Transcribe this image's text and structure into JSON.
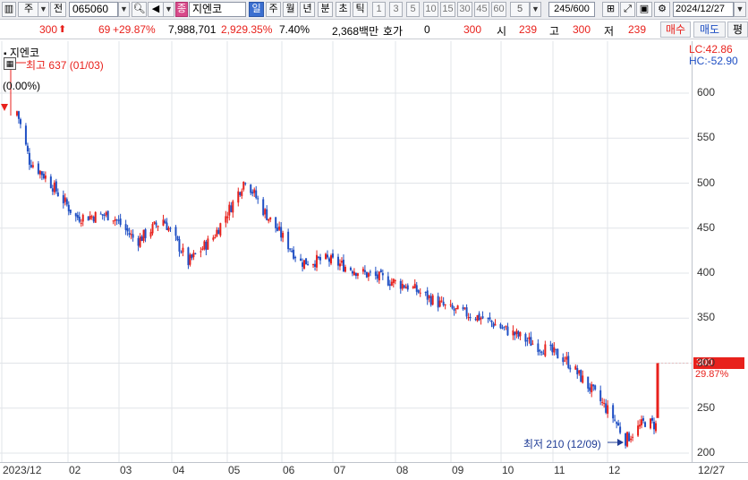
{
  "toolbar": {
    "market": "주",
    "type_label": "전",
    "code": "065060",
    "badge": "종",
    "name": "지엔코",
    "periods": [
      "일",
      "주",
      "월",
      "년",
      "분",
      "초",
      "틱"
    ],
    "selected_period": "일",
    "numbers": [
      "1",
      "3",
      "5",
      "10",
      "15",
      "30",
      "45",
      "60"
    ],
    "n_value": "5",
    "count": "245/600",
    "date": "2024/12/27"
  },
  "info": {
    "price": "300",
    "change": "69",
    "change_pct": "+29.87%",
    "volume": "7,988,701",
    "vol_pct": "2,929.35%",
    "turnover": "7.40%",
    "amount": "2,368백만",
    "hoga_label": "호가",
    "hoga_value": "0",
    "hoga_price": "300",
    "open_label": "시",
    "open": "239",
    "high_label": "고",
    "high": "300",
    "low_label": "저",
    "low": "239",
    "buy_label": "매수",
    "sell_label": "매도",
    "eval_label": "평"
  },
  "chart": {
    "legend_name": "지엔코",
    "max_label": "최고 637 (01/03)",
    "pct_label": "(0.00%)",
    "min_label": "최저 210 (12/09)",
    "lc_label": "LC:42.86",
    "hc_label": "HC:-52.90",
    "last_price": "300",
    "last_pct": "29.87%",
    "y_ticks": [
      "600",
      "550",
      "500",
      "450",
      "400",
      "350",
      "300",
      "250",
      "200"
    ],
    "x_ticks": [
      "2023/12",
      "02",
      "03",
      "04",
      "05",
      "06",
      "07",
      "08",
      "09",
      "10",
      "11",
      "12",
      "12/27"
    ],
    "colors": {
      "up": "#e8211c",
      "down": "#1f4fc4",
      "grid": "#e1e4e8"
    }
  },
  "chart_data": {
    "type": "candlestick",
    "ylim": [
      200,
      610
    ],
    "x_start": "2023/12",
    "x_end": "12/27",
    "anchors": [
      {
        "x": "2024/01/03",
        "close": 580
      },
      {
        "x": "2024/01/10",
        "close": 525
      },
      {
        "x": "2024/01/20",
        "close": 505
      },
      {
        "x": "2024/02/05",
        "close": 462
      },
      {
        "x": "2024/02/25",
        "close": 465
      },
      {
        "x": "2024/03/10",
        "close": 435
      },
      {
        "x": "2024/03/25",
        "close": 460
      },
      {
        "x": "2024/04/08",
        "close": 412
      },
      {
        "x": "2024/04/22",
        "close": 440
      },
      {
        "x": "2024/05/03",
        "close": 478
      },
      {
        "x": "2024/05/10",
        "close": 505
      },
      {
        "x": "2024/05/20",
        "close": 470
      },
      {
        "x": "2024/06/10",
        "close": 412
      },
      {
        "x": "2024/06/25",
        "close": 415
      },
      {
        "x": "2024/07/15",
        "close": 400
      },
      {
        "x": "2024/08/10",
        "close": 385
      },
      {
        "x": "2024/09/01",
        "close": 360
      },
      {
        "x": "2024/09/20",
        "close": 350
      },
      {
        "x": "2024/10/15",
        "close": 325
      },
      {
        "x": "2024/11/05",
        "close": 305
      },
      {
        "x": "2024/11/20",
        "close": 270
      },
      {
        "x": "2024/12/02",
        "close": 240
      },
      {
        "x": "2024/12/09",
        "close": 215
      },
      {
        "x": "2024/12/20",
        "close": 235
      },
      {
        "x": "2024/12/26",
        "close": 231
      },
      {
        "x": "2024/12/27",
        "close": 300
      }
    ],
    "last_candle": {
      "open": 239,
      "high": 300,
      "low": 239,
      "close": 300
    },
    "max": 637,
    "min": 210
  }
}
